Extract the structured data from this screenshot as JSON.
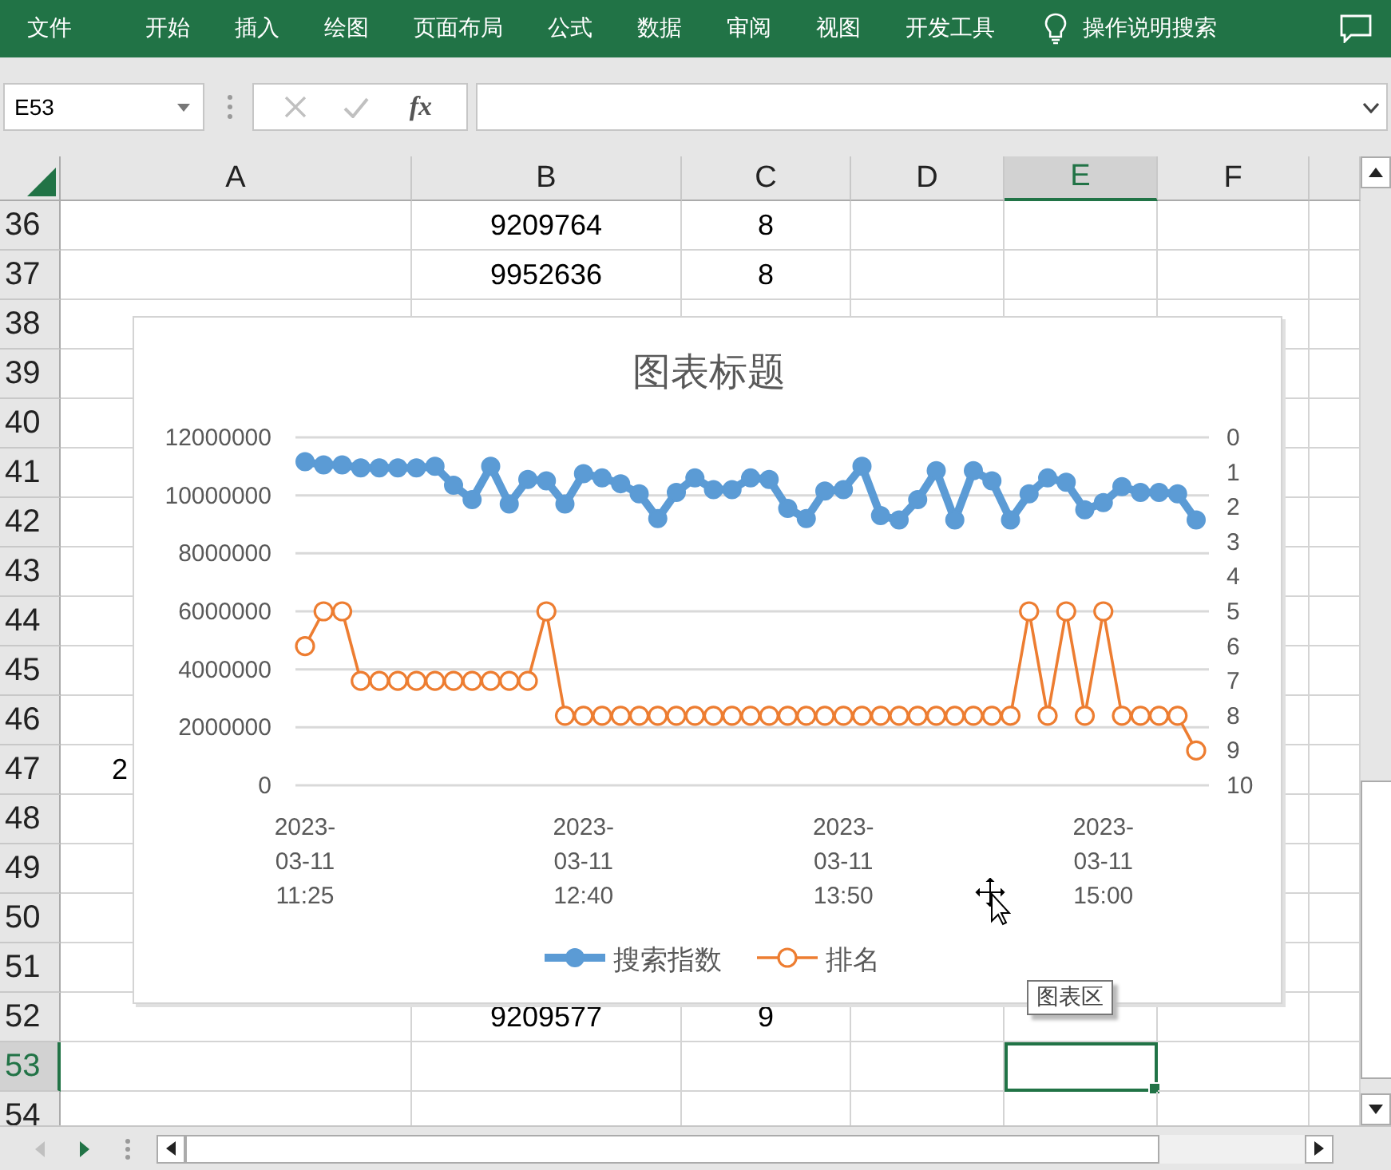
{
  "ribbon": {
    "tabs": [
      {
        "label": "文件",
        "selected": false
      },
      {
        "label": "开始",
        "selected": false
      },
      {
        "label": "插入",
        "selected": false
      },
      {
        "label": "绘图",
        "selected": false
      },
      {
        "label": "页面布局",
        "selected": false
      },
      {
        "label": "公式",
        "selected": false
      },
      {
        "label": "数据",
        "selected": false
      },
      {
        "label": "审阅",
        "selected": false
      },
      {
        "label": "视图",
        "selected": false
      },
      {
        "label": "开发工具",
        "selected": false
      }
    ],
    "search": {
      "label": "操作说明搜索"
    }
  },
  "formula_bar": {
    "name_box": "E53",
    "function_button": "fx"
  },
  "sheet": {
    "columns": [
      {
        "label": "A",
        "selected": false
      },
      {
        "label": "B",
        "selected": false
      },
      {
        "label": "C",
        "selected": false
      },
      {
        "label": "D",
        "selected": false
      },
      {
        "label": "E",
        "selected": true
      },
      {
        "label": "F",
        "selected": false
      }
    ],
    "rows": [
      {
        "header": "36",
        "selected": false,
        "cells": [
          null,
          "9209764",
          "8",
          null,
          null,
          null
        ]
      },
      {
        "header": "37",
        "selected": false,
        "cells": [
          null,
          "9952636",
          "8",
          null,
          null,
          null
        ]
      },
      {
        "header": "38",
        "selected": false,
        "cells": [
          null,
          null,
          null,
          null,
          null,
          null
        ]
      },
      {
        "header": "39",
        "selected": false,
        "cells": [
          null,
          null,
          null,
          null,
          null,
          null
        ]
      },
      {
        "header": "40",
        "selected": false,
        "cells": [
          null,
          null,
          null,
          null,
          null,
          null
        ]
      },
      {
        "header": "41",
        "selected": false,
        "cells": [
          null,
          null,
          null,
          null,
          null,
          null
        ]
      },
      {
        "header": "42",
        "selected": false,
        "cells": [
          null,
          null,
          null,
          null,
          null,
          null
        ]
      },
      {
        "header": "43",
        "selected": false,
        "cells": [
          null,
          null,
          null,
          null,
          null,
          null
        ]
      },
      {
        "header": "44",
        "selected": false,
        "cells": [
          null,
          null,
          null,
          null,
          null,
          null
        ]
      },
      {
        "header": "45",
        "selected": false,
        "cells": [
          null,
          null,
          null,
          null,
          null,
          null
        ]
      },
      {
        "header": "46",
        "selected": false,
        "cells": [
          null,
          null,
          null,
          null,
          null,
          null
        ]
      },
      {
        "header": "47",
        "selected": false,
        "cells": [
          "2",
          null,
          null,
          null,
          null,
          null
        ]
      },
      {
        "header": "48",
        "selected": false,
        "cells": [
          null,
          null,
          null,
          null,
          null,
          null
        ]
      },
      {
        "header": "49",
        "selected": false,
        "cells": [
          null,
          null,
          null,
          null,
          null,
          null
        ]
      },
      {
        "header": "50",
        "selected": false,
        "cells": [
          null,
          null,
          null,
          null,
          null,
          null
        ]
      },
      {
        "header": "51",
        "selected": false,
        "cells": [
          null,
          null,
          null,
          null,
          null,
          null
        ]
      },
      {
        "header": "52",
        "selected": false,
        "cells": [
          null,
          "9209577",
          "9",
          null,
          null,
          null
        ]
      },
      {
        "header": "53",
        "selected": true,
        "cells": [
          null,
          null,
          null,
          null,
          null,
          null
        ]
      },
      {
        "header": "54",
        "selected": false,
        "cells": [
          null,
          null,
          null,
          null,
          null,
          null
        ]
      }
    ]
  },
  "chart": {
    "tooltip": "图表区",
    "series_styles": [
      {
        "hollow": false
      },
      {
        "hollow": true
      }
    ],
    "chart_data": {
      "type": "line",
      "title": "图表标题",
      "categories": [
        "2023-\n03-11\n11:25",
        null,
        null,
        null,
        null,
        null,
        null,
        null,
        null,
        null,
        null,
        null,
        null,
        null,
        null,
        "2023-\n03-11\n12:40",
        null,
        null,
        null,
        null,
        null,
        null,
        null,
        null,
        null,
        null,
        null,
        null,
        null,
        "2023-\n03-11\n13:50",
        null,
        null,
        null,
        null,
        null,
        null,
        null,
        null,
        null,
        null,
        null,
        null,
        null,
        "2023-\n03-11\n15:00",
        null,
        null,
        null,
        null,
        null
      ],
      "ylim": [
        0,
        12000000
      ],
      "yticks": [
        0,
        2000000,
        4000000,
        6000000,
        8000000,
        10000000,
        12000000
      ],
      "grid": true,
      "legend": true,
      "y2lim": [
        10,
        0
      ],
      "y2ticks": [
        0,
        1,
        2,
        3,
        4,
        5,
        6,
        7,
        8,
        9,
        10
      ],
      "series": [
        {
          "name": "搜索指数",
          "color": "#5b9bd5",
          "marker": "circle",
          "values": [
            11160000,
            11050000,
            11050000,
            10950000,
            10950000,
            10950000,
            10950000,
            11000000,
            10350000,
            9850000,
            11000000,
            9700000,
            10550000,
            10500000,
            9700000,
            10750000,
            10600000,
            10400000,
            10050000,
            9200000,
            10100000,
            10600000,
            10200000,
            10200000,
            10600000,
            10550000,
            9550000,
            9200000,
            10150000,
            10200000,
            11000000,
            9300000,
            9150000,
            9850000,
            10850000,
            9150000,
            10850000,
            10500000,
            9150000,
            10050000,
            10600000,
            10450000,
            9500000,
            9750000,
            10300000,
            10100000,
            10100000,
            10050000,
            9150000
          ]
        },
        {
          "name": "排名",
          "color": "#ed7d31",
          "axis": "y2",
          "marker": "circle",
          "values": [
            6,
            5,
            5,
            7,
            7,
            7,
            7,
            7,
            7,
            7,
            7,
            7,
            7,
            5,
            8,
            8,
            8,
            8,
            8,
            8,
            8,
            8,
            8,
            8,
            8,
            8,
            8,
            8,
            8,
            8,
            8,
            8,
            8,
            8,
            8,
            8,
            8,
            8,
            8,
            5,
            8,
            5,
            8,
            5,
            8,
            8,
            8,
            8,
            9
          ]
        }
      ]
    }
  }
}
